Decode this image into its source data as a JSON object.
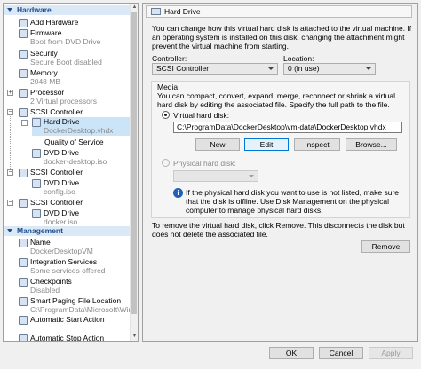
{
  "tree": {
    "hardware_header": "Hardware",
    "management_header": "Management",
    "items": [
      {
        "label": "Add Hardware",
        "sub": ""
      },
      {
        "label": "Firmware",
        "sub": "Boot from DVD Drive"
      },
      {
        "label": "Security",
        "sub": "Secure Boot disabled"
      },
      {
        "label": "Memory",
        "sub": "2048 MB"
      },
      {
        "label": "Processor",
        "sub": "2 Virtual processors"
      },
      {
        "label": "SCSI Controller",
        "sub": ""
      },
      {
        "label": "Hard Drive",
        "sub": "DockerDesktop.vhdx"
      },
      {
        "label": "Quality of Service",
        "sub": ""
      },
      {
        "label": "DVD Drive",
        "sub": "docker-desktop.iso"
      },
      {
        "label": "SCSI Controller",
        "sub": ""
      },
      {
        "label": "DVD Drive",
        "sub": "config.iso"
      },
      {
        "label": "SCSI Controller",
        "sub": ""
      },
      {
        "label": "DVD Drive",
        "sub": "docker.iso"
      }
    ],
    "mgmt_items": [
      {
        "label": "Name",
        "sub": "DockerDesktopVM"
      },
      {
        "label": "Integration Services",
        "sub": "Some services offered"
      },
      {
        "label": "Checkpoints",
        "sub": "Disabled"
      },
      {
        "label": "Smart Paging File Location",
        "sub": "C:\\ProgramData\\Microsoft\\Win..."
      },
      {
        "label": "Automatic Start Action",
        "sub": ""
      },
      {
        "label": "Automatic Stop Action",
        "sub": ""
      }
    ]
  },
  "panel": {
    "title": "Hard Drive",
    "intro": "You can change how this virtual hard disk is attached to the virtual machine. If an operating system is installed on this disk, changing the attachment might prevent the virtual machine from starting.",
    "controller_label": "Controller:",
    "controller_value": "SCSI Controller",
    "location_label": "Location:",
    "location_value": "0 (in use)",
    "media_label": "Media",
    "media_desc": "You can compact, convert, expand, merge, reconnect or shrink a virtual hard disk by editing the associated file. Specify the full path to the file.",
    "vhd_label": "Virtual hard disk:",
    "vhd_path": "C:\\ProgramData\\DockerDesktop\\vm-data\\DockerDesktop.vhdx",
    "btn_new": "New",
    "btn_edit": "Edit",
    "btn_inspect": "Inspect",
    "btn_browse": "Browse...",
    "phys_label": "Physical hard disk:",
    "phys_info": "If the physical hard disk you want to use is not listed, make sure that the disk is offline. Use Disk Management on the physical computer to manage physical hard disks.",
    "remove_desc": "To remove the virtual hard disk, click Remove. This disconnects the disk but does not delete the associated file.",
    "btn_remove": "Remove"
  },
  "footer": {
    "ok": "OK",
    "cancel": "Cancel",
    "apply": "Apply"
  },
  "icons": {
    "info": "info-icon",
    "radio": "radio-icon"
  },
  "colors": {
    "accent": "#0078d7",
    "header_bg": "#dbe8f6",
    "header_text": "#1f4e8c",
    "selection": "#cce4f7"
  }
}
